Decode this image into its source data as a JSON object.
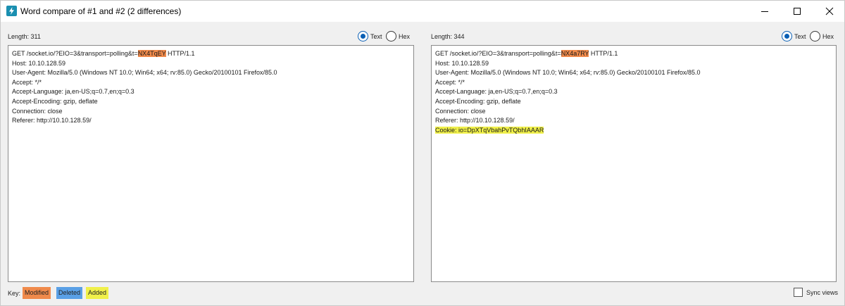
{
  "window": {
    "title": "Word compare of #1 and #2  (2 differences)",
    "controls": [
      "minimize-icon",
      "maximize-icon",
      "close-icon"
    ]
  },
  "left": {
    "length_label": "Length: 311",
    "text_option": "Text",
    "hex_option": "Hex",
    "selected_mode": "Text",
    "lines": {
      "l0a": "GET /socket.io/?EIO=3&transport=polling&t=",
      "l0b": "NX4TqEY",
      "l0c": " HTTP/1.1",
      "l1": "Host: 10.10.128.59",
      "l2": "User-Agent: Mozilla/5.0 (Windows NT 10.0; Win64; x64; rv:85.0) Gecko/20100101 Firefox/85.0",
      "l3": "Accept: */*",
      "l4": "Accept-Language: ja,en-US;q=0.7,en;q=0.3",
      "l5": "Accept-Encoding: gzip, deflate",
      "l6": "Connection: close",
      "l7": "Referer: http://10.10.128.59/"
    }
  },
  "right": {
    "length_label": "Length: 344",
    "text_option": "Text",
    "hex_option": "Hex",
    "selected_mode": "Text",
    "lines": {
      "l0a": "GET /socket.io/?EIO=3&transport=polling&t=",
      "l0b": "NX4a7RY",
      "l0c": " HTTP/1.1",
      "l1": "Host: 10.10.128.59",
      "l2": "User-Agent: Mozilla/5.0 (Windows NT 10.0; Win64; x64; rv:85.0) Gecko/20100101 Firefox/85.0",
      "l3": "Accept: */*",
      "l4": "Accept-Language: ja,en-US;q=0.7,en;q=0.3",
      "l5": "Accept-Encoding: gzip, deflate",
      "l6": "Connection: close",
      "l7": "Referer: http://10.10.128.59/",
      "l8": "Cookie: io=DpXTqVbahPvTQbhIAAAR"
    }
  },
  "footer": {
    "key_label": "Key:",
    "modified": "Modified",
    "deleted": "Deleted",
    "added": "Added",
    "sync_label": "Sync views",
    "sync_checked": false
  },
  "colors": {
    "modified": "#f08a4b",
    "deleted": "#5aa0e6",
    "added": "#f0f04a",
    "accent": "#0a5fb4",
    "app_icon": "#1a8fb0"
  }
}
